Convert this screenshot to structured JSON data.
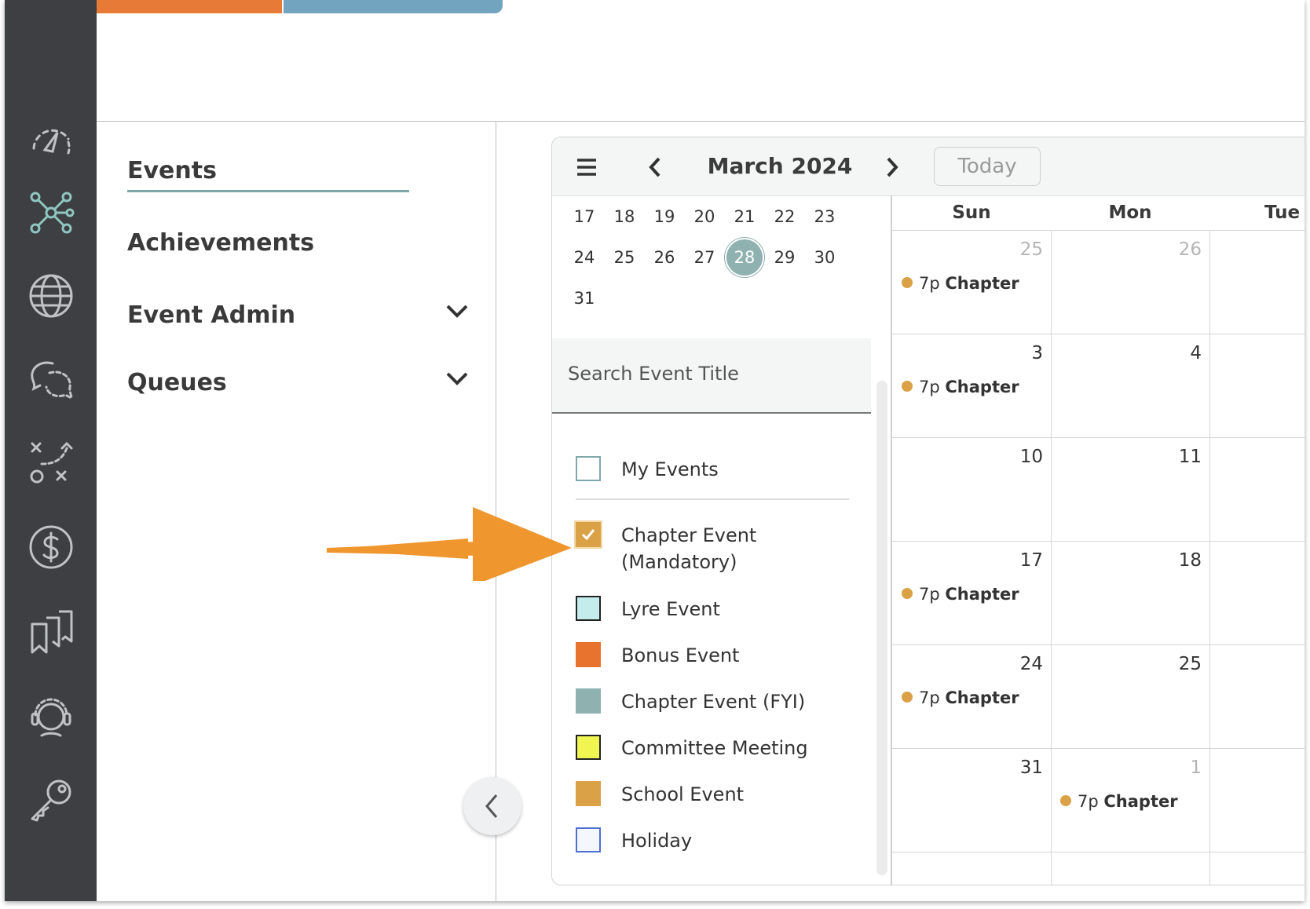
{
  "colors": {
    "sidebar_bg": "#3d3f42",
    "accent_teal": "#7fa8ad",
    "top_orange": "#e77a36",
    "top_blue": "#73a4bf",
    "event_dot": "#dba146",
    "annotation_arrow": "#f0962f"
  },
  "sidebar": {
    "icons": [
      "dashboard-gauge-icon",
      "network-nodes-icon",
      "globe-icon",
      "chat-bubbles-icon",
      "strategy-play-icon",
      "dollar-icon",
      "bookmarks-icon",
      "support-headset-icon",
      "key-icon"
    ],
    "active_icon": "network-nodes-icon"
  },
  "nav": {
    "items": [
      {
        "label": "Events",
        "active": true
      },
      {
        "label": "Achievements",
        "active": false
      },
      {
        "label": "Event Admin",
        "expandable": true
      },
      {
        "label": "Queues",
        "expandable": true
      }
    ]
  },
  "calendar": {
    "toolbar": {
      "menu_icon": "hamburger-menu-icon",
      "prev_icon": "chevron-left-icon",
      "next_icon": "chevron-right-icon",
      "month_title": "March 2024",
      "today_label": "Today"
    },
    "mini": {
      "rows": [
        [
          "17",
          "18",
          "19",
          "20",
          "21",
          "22",
          "23"
        ],
        [
          "24",
          "25",
          "26",
          "27",
          "28",
          "29",
          "30"
        ],
        [
          "31"
        ]
      ],
      "selected": "28"
    },
    "search": {
      "placeholder": "Search Event Title"
    },
    "filters": [
      {
        "label": "My Events",
        "checked": false,
        "color": "#ffffff",
        "border": "#7fa8ad"
      },
      {
        "label": "Chapter Event",
        "label2": "(Mandatory)",
        "checked": true,
        "color": "#dba146",
        "border": "#dba146"
      },
      {
        "label": "Lyre Event",
        "checked": false,
        "color": "#c4ecec",
        "border": "#222222"
      },
      {
        "label": "Bonus Event",
        "checked": false,
        "color": "#e7732f",
        "border": "#e7732f"
      },
      {
        "label": "Chapter Event (FYI)",
        "checked": false,
        "color": "#8fb1af",
        "border": "#8fb1af"
      },
      {
        "label": "Committee Meeting",
        "checked": false,
        "color": "#f0f552",
        "border": "#222222"
      },
      {
        "label": "School Event",
        "checked": false,
        "color": "#dba146",
        "border": "#dba146"
      },
      {
        "label": "Holiday",
        "checked": false,
        "color": "#f5f7ff",
        "border": "#4e6fd6"
      }
    ],
    "weekdays": [
      "Sun",
      "Mon",
      "Tue"
    ],
    "weeks": [
      {
        "sun": "25",
        "mon": "26",
        "sun_muted": true,
        "mon_muted": true,
        "sun_event": "7p",
        "sun_event_title": "Chapter"
      },
      {
        "sun": "3",
        "mon": "4",
        "sun_event": "7p",
        "sun_event_title": "Chapter"
      },
      {
        "sun": "10",
        "mon": "11"
      },
      {
        "sun": "17",
        "mon": "18",
        "sun_event": "7p",
        "sun_event_title": "Chapter"
      },
      {
        "sun": "24",
        "mon": "25",
        "sun_event": "7p",
        "sun_event_title": "Chapter"
      },
      {
        "sun": "31",
        "mon": "1",
        "mon_muted": true,
        "mon_event": "7p",
        "mon_event_title": "Chapter"
      }
    ]
  }
}
